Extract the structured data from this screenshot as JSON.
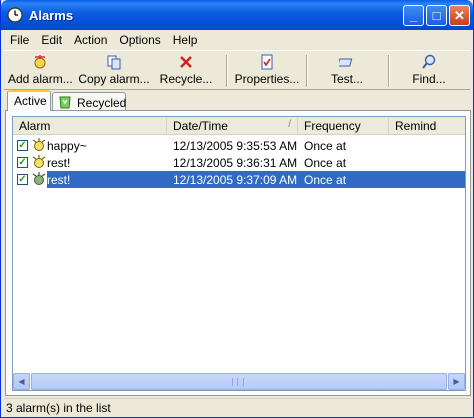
{
  "window": {
    "title": "Alarms"
  },
  "menu": [
    "File",
    "Edit",
    "Action",
    "Options",
    "Help"
  ],
  "toolbar": {
    "add_label": "Add alarm...",
    "copy_label": "Copy alarm...",
    "recycle_label": "Recycle...",
    "properties_label": "Properties...",
    "test_label": "Test...",
    "find_label": "Find..."
  },
  "tabs": {
    "active": "Active",
    "recycled": "Recycled"
  },
  "columns": {
    "alarm": "Alarm",
    "datetime": "Date/Time",
    "frequency": "Frequency",
    "remind": "Remind"
  },
  "rows": [
    {
      "name": "happy~",
      "datetime": "12/13/2005 9:35:53 AM",
      "frequency": "Once at",
      "checked": true
    },
    {
      "name": "rest!",
      "datetime": "12/13/2005 9:36:31 AM",
      "frequency": "Once at",
      "checked": true
    },
    {
      "name": "rest!",
      "datetime": "12/13/2005 9:37:09 AM",
      "frequency": "Once at",
      "checked": true
    }
  ],
  "status": {
    "text": "3 alarm(s) in the list"
  },
  "colors": {
    "titlebar": "#0550d6",
    "selection": "#316ac5",
    "tab_highlight": "#ffc83c"
  }
}
